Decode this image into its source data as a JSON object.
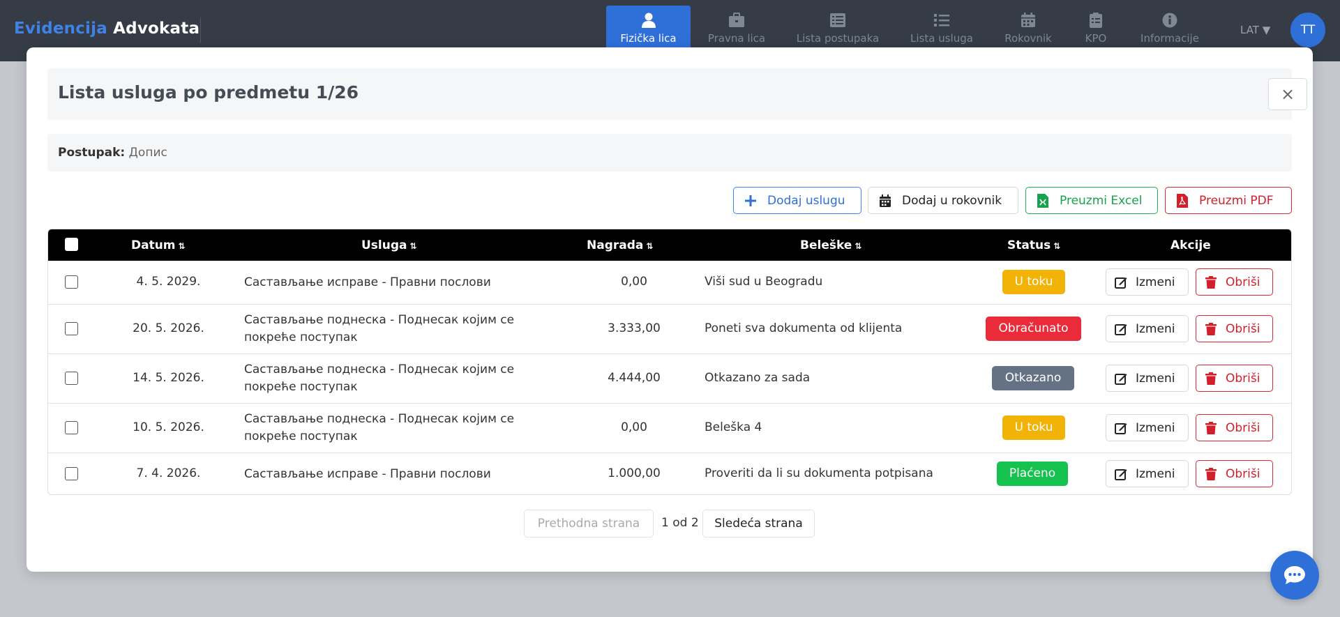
{
  "app": {
    "brand_part1": "Evidencija",
    "brand_part2": "Advokata"
  },
  "nav": [
    {
      "label": "Fizička lica",
      "icon": "user-icon",
      "active": true
    },
    {
      "label": "Pravna lica",
      "icon": "briefcase-icon",
      "active": false
    },
    {
      "label": "Lista postupaka",
      "icon": "list-alt-icon",
      "active": false
    },
    {
      "label": "Lista usluga",
      "icon": "list-icon",
      "active": false
    },
    {
      "label": "Rokovnik",
      "icon": "calendar-icon",
      "active": false
    },
    {
      "label": "KPO",
      "icon": "clipboard-icon",
      "active": false
    },
    {
      "label": "Informacije",
      "icon": "info-icon",
      "active": false
    }
  ],
  "lang": {
    "label": "LAT ▼"
  },
  "user": {
    "initials": "TT"
  },
  "modal": {
    "title": "Lista usluga po predmetu 1/26",
    "close": "×",
    "postupak_label": "Postupak:",
    "postupak_value": "Допис"
  },
  "toolbar": {
    "add_service": "Dodaj uslugu",
    "add_calendar": "Dodaj u rokovnik",
    "export_excel": "Preuzmi Excel",
    "export_pdf": "Preuzmi PDF"
  },
  "table": {
    "headers": {
      "datum": "Datum",
      "usluga": "Usluga",
      "nagrada": "Nagrada",
      "beleske": "Beleške",
      "status": "Status",
      "akcije": "Akcije"
    },
    "sort_glyph": "⇅",
    "edit_label": "Izmeni",
    "delete_label": "Obriši",
    "rows": [
      {
        "datum": "4. 5. 2029.",
        "usluga": "Састављање исправе - Правни послови",
        "nagrada": "0,00",
        "beleske": "Viši sud u Beogradu",
        "status": "U toku",
        "status_color": "#f2b306"
      },
      {
        "datum": "20. 5. 2026.",
        "usluga": "Састављање поднеска - Поднесак којим се покреће поступак",
        "nagrada": "3.333,00",
        "beleske": "Poneti sva dokumenta od klijenta",
        "status": "Obračunato",
        "status_color": "#ea2b3a"
      },
      {
        "datum": "14. 5. 2026.",
        "usluga": "Састављање поднеска - Поднесак којим се покреће поступак",
        "nagrada": "4.444,00",
        "beleske": "Otkazano za sada",
        "status": "Otkazano",
        "status_color": "#657184"
      },
      {
        "datum": "10. 5. 2026.",
        "usluga": "Састављање поднеска - Поднесак којим се покреће поступак",
        "nagrada": "0,00",
        "beleske": "Beleška 4",
        "status": "U toku",
        "status_color": "#f2b306"
      },
      {
        "datum": "7. 4. 2026.",
        "usluga": "Састављање исправе - Правни послови",
        "nagrada": "1.000,00",
        "beleske": "Proveriti da li su dokumenta potpisana",
        "status": "Plaćeno",
        "status_color": "#15c24e"
      }
    ]
  },
  "pagination": {
    "prev": "Prethodna strana",
    "info": "1 od 2",
    "next": "Sledeća strana"
  }
}
